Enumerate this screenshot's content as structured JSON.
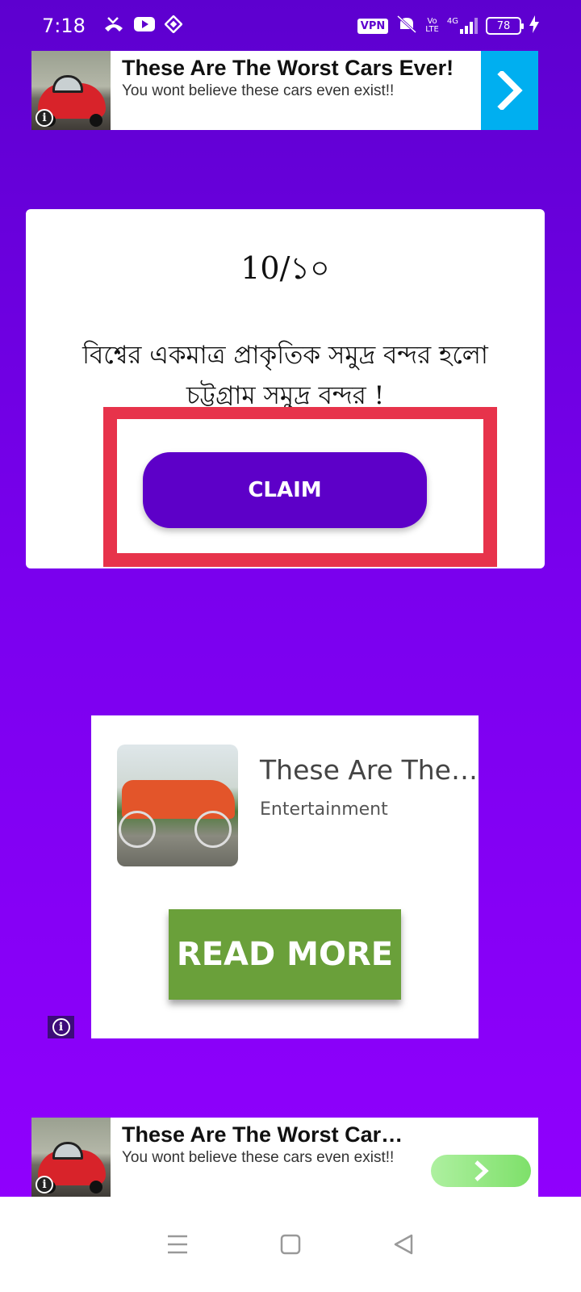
{
  "status_bar": {
    "time": "7:18",
    "vpn": "VPN",
    "network_top": "Vo",
    "network_bottom": "LTE",
    "network_type": "4G",
    "battery": "78",
    "icons": [
      "missed-call-icon",
      "youtube-icon",
      "binance-icon",
      "mute-icon",
      "signal-icon",
      "charging-icon"
    ]
  },
  "top_ad": {
    "title": "These Are The Worst Cars Ever!",
    "subtitle": "You wont believe these cars even exist!!",
    "info_label": "i",
    "arrow_color": "#00aff0"
  },
  "quiz": {
    "counter": "10/১০",
    "fact": "বিশ্বের একমাত্র প্রাকৃতিক সমুদ্র বন্দর হলো চট্টগ্রাম সমুদ্র বন্দর !",
    "claim_label": "CLAIM",
    "highlight_color": "#e7334b",
    "button_color": "#5d00c8"
  },
  "native_ad": {
    "title": "These Are The…",
    "category": "Entertainment",
    "read_more_label": "READ MORE",
    "button_color": "#6aa03a",
    "info_label": "i"
  },
  "bottom_ad": {
    "title": "These Are The Worst Cars…",
    "subtitle": "You wont believe these cars even exist!!",
    "info_label": "i"
  },
  "nav_bar": {
    "icons": [
      "menu-icon",
      "home-icon",
      "back-icon"
    ]
  }
}
